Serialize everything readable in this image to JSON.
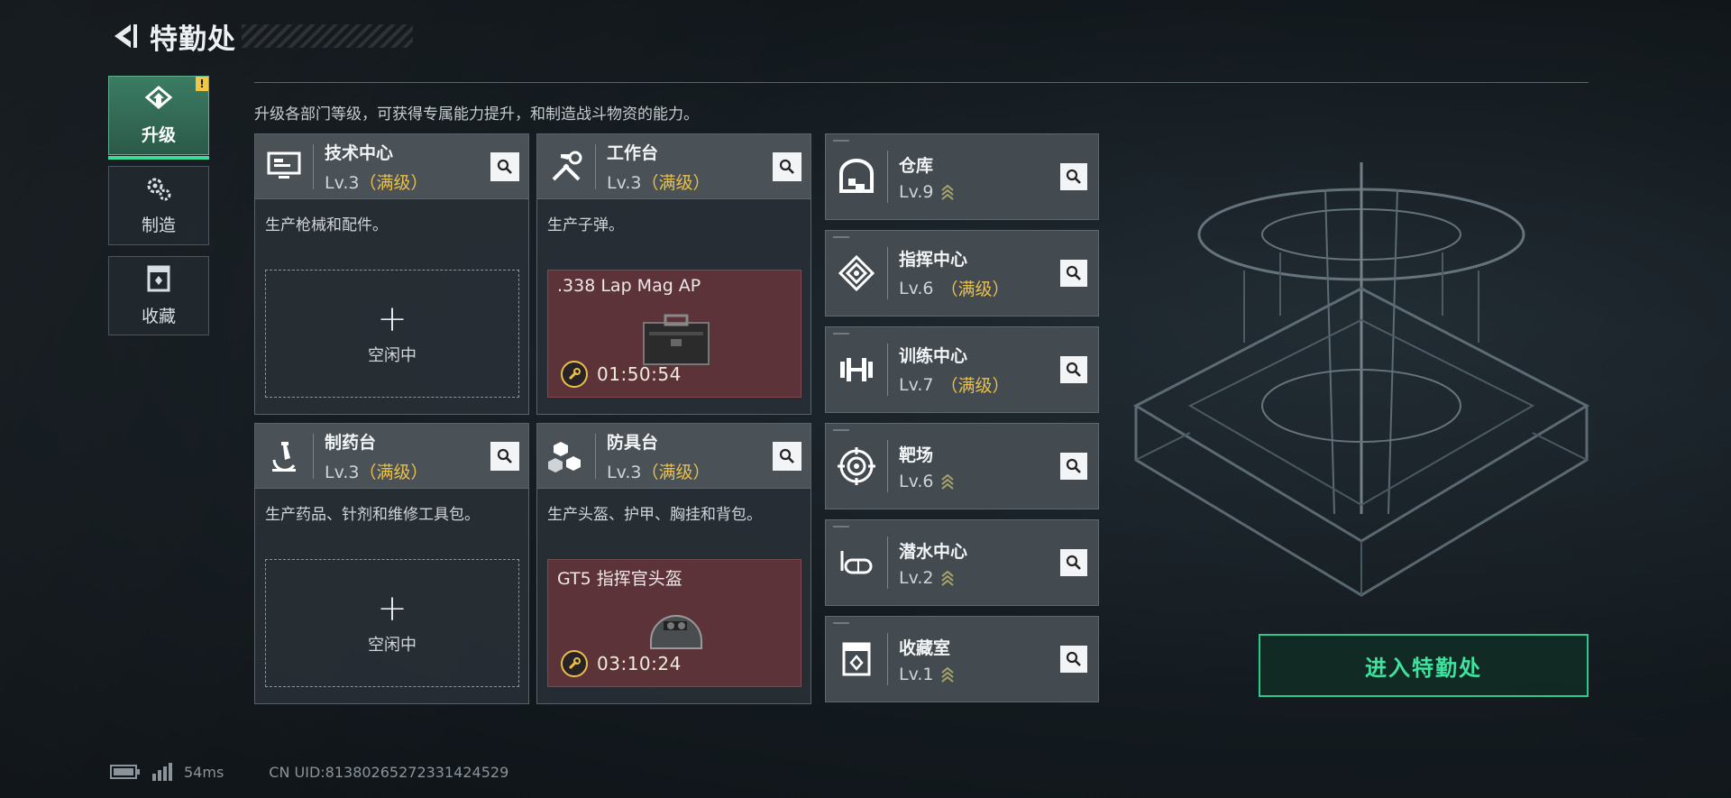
{
  "header": {
    "title": "特勤处"
  },
  "nav": {
    "items": [
      {
        "label": "升级",
        "icon": "upgrade-icon",
        "active": true,
        "alert": "!"
      },
      {
        "label": "制造",
        "icon": "gears-icon",
        "active": false
      },
      {
        "label": "收藏",
        "icon": "collection-icon",
        "active": false
      }
    ]
  },
  "description": "升级各部门等级，可获得专属能力提升，和制造战斗物资的能力。",
  "departments": [
    {
      "name": "技术中心",
      "level": "Lv.3",
      "maxed": "（满级）",
      "icon": "monitor-icon",
      "desc": "生产枪械和配件。",
      "slot": {
        "state": "idle",
        "label": "空闲中",
        "plus": "+"
      }
    },
    {
      "name": "工作台",
      "level": "Lv.3",
      "maxed": "（满级）",
      "icon": "tools-icon",
      "desc": "生产子弹。",
      "slot": {
        "state": "producing",
        "item": ".338 Lap Mag AP",
        "timer": "01:50:54"
      }
    },
    {
      "name": "制药台",
      "level": "Lv.3",
      "maxed": "（满级）",
      "icon": "microscope-icon",
      "desc": "生产药品、针剂和维修工具包。",
      "slot": {
        "state": "idle",
        "label": "空闲中",
        "plus": "+"
      }
    },
    {
      "name": "防具台",
      "level": "Lv.3",
      "maxed": "（满级）",
      "icon": "armor-cubes-icon",
      "desc": "生产头盔、护甲、胸挂和背包。",
      "slot": {
        "state": "producing",
        "item": "GT5 指挥官头盔",
        "timer": "03:10:24"
      }
    }
  ],
  "facilities": [
    {
      "name": "仓库",
      "level": "Lv.9",
      "maxed": "",
      "upgradable": true,
      "icon": "warehouse-icon"
    },
    {
      "name": "指挥中心",
      "level": "Lv.6",
      "maxed": "（满级）",
      "upgradable": false,
      "icon": "command-icon"
    },
    {
      "name": "训练中心",
      "level": "Lv.7",
      "maxed": "（满级）",
      "upgradable": false,
      "icon": "dumbbell-icon"
    },
    {
      "name": "靶场",
      "level": "Lv.6",
      "maxed": "",
      "upgradable": true,
      "icon": "target-icon"
    },
    {
      "name": "潜水中心",
      "level": "Lv.2",
      "maxed": "",
      "upgradable": true,
      "icon": "dive-mask-icon"
    },
    {
      "name": "收藏室",
      "level": "Lv.1",
      "maxed": "",
      "upgradable": true,
      "icon": "collection-room-icon"
    }
  ],
  "enter_button": "进入特勤处",
  "footer": {
    "ping": "54ms",
    "uid": "CN UID:8138026527233142452​9"
  },
  "colors": {
    "accent": "#3ee3a0",
    "maxed": "#e8c04a",
    "producing_bg": "#5c3338"
  }
}
